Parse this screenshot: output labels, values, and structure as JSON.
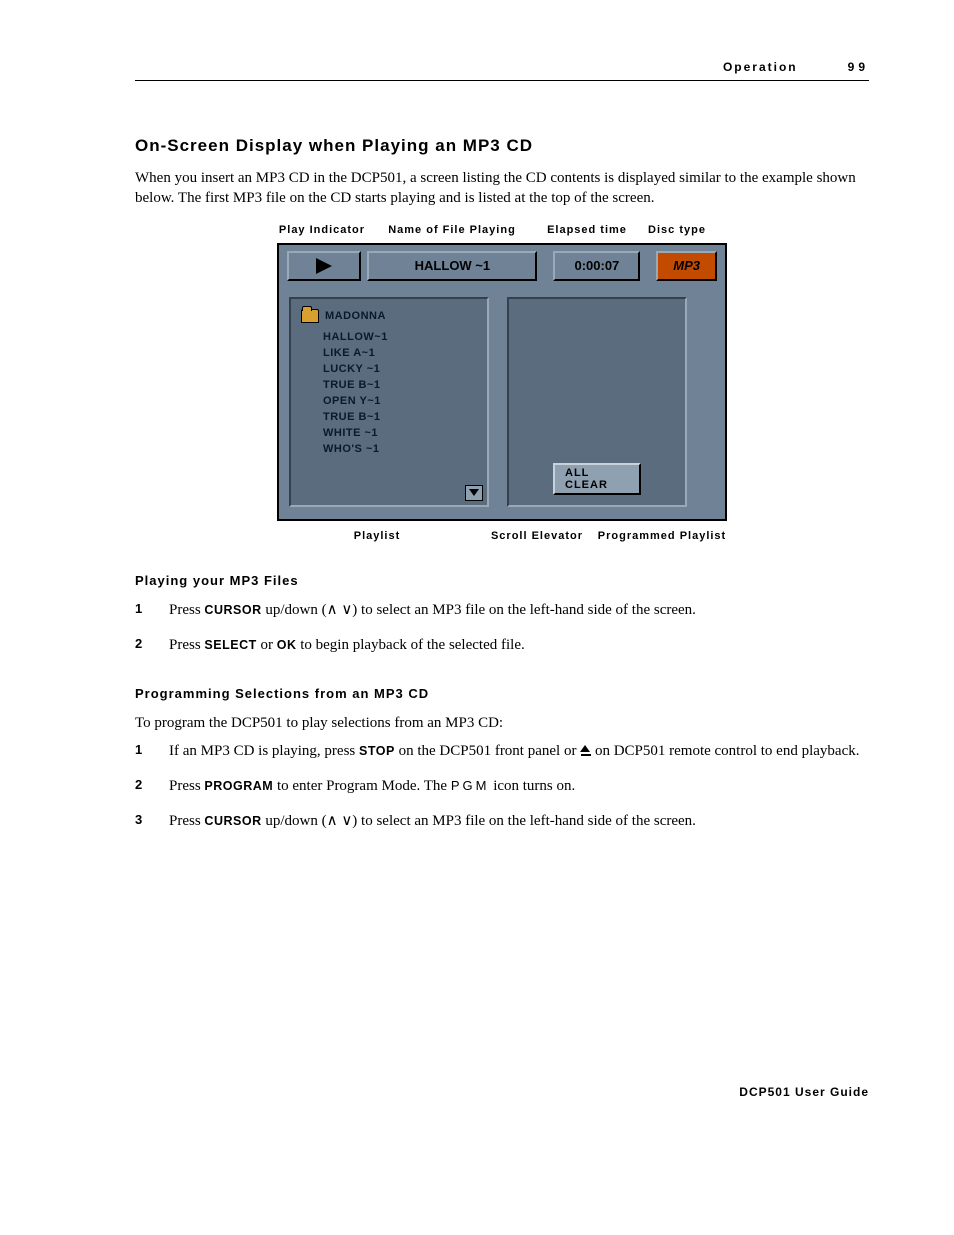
{
  "header": {
    "section": "Operation",
    "page": "99"
  },
  "title": "On-Screen Display when Playing an MP3 CD",
  "intro": "When you insert an MP3 CD in the DCP501, a screen listing the CD contents is displayed similar to the example shown below. The first MP3 file on the CD starts playing and is listed at the top of the screen.",
  "top_labels": {
    "play": "Play Indicator",
    "name": "Name of File Playing",
    "time": "Elapsed time",
    "disc": "Disc type"
  },
  "osd": {
    "file_playing": "HALLOW ~1",
    "elapsed": "0:00:07",
    "disc_type": "MP3",
    "folder": "MADONNA",
    "tracks": [
      "HALLOW~1",
      "LIKE A~1",
      "LUCKY ~1",
      "TRUE B~1",
      "OPEN Y~1",
      "TRUE B~1",
      "WHITE ~1",
      "WHO'S ~1"
    ],
    "all_clear": "ALL CLEAR"
  },
  "bottom_labels": {
    "playlist": "Playlist",
    "scroll": "Scroll Elevator",
    "programmed": "Programmed Playlist"
  },
  "sub1_title": "Playing your MP3 Files",
  "sub1_steps": {
    "s1_a": "Press ",
    "s1_kw": "CURSOR",
    "s1_b": " up/down (∧ ∨) to select an MP3 file on the left-hand side of the screen.",
    "s2_a": "Press ",
    "s2_kw1": "SELECT",
    "s2_b": " or ",
    "s2_kw2": "OK",
    "s2_c": " to begin playback of the selected file."
  },
  "sub2_title": "Programming Selections from an MP3 CD",
  "sub2_intro": "To program the DCP501 to play selections from an MP3 CD:",
  "sub2_steps": {
    "s1_a": "If an MP3 CD is playing, press ",
    "s1_kw": "STOP",
    "s1_b": " on the DCP501 front panel or ",
    "s1_c": " on DCP501 remote control to end playback.",
    "s2_a": "Press ",
    "s2_kw": "PROGRAM",
    "s2_b": " to enter Program Mode. The ",
    "s2_pgm": "PGM",
    "s2_c": " icon turns on.",
    "s3_a": "Press ",
    "s3_kw": "CURSOR",
    "s3_b": " up/down (∧ ∨) to select an MP3 file on the left-hand side of the screen."
  },
  "footer": "DCP501 User Guide"
}
